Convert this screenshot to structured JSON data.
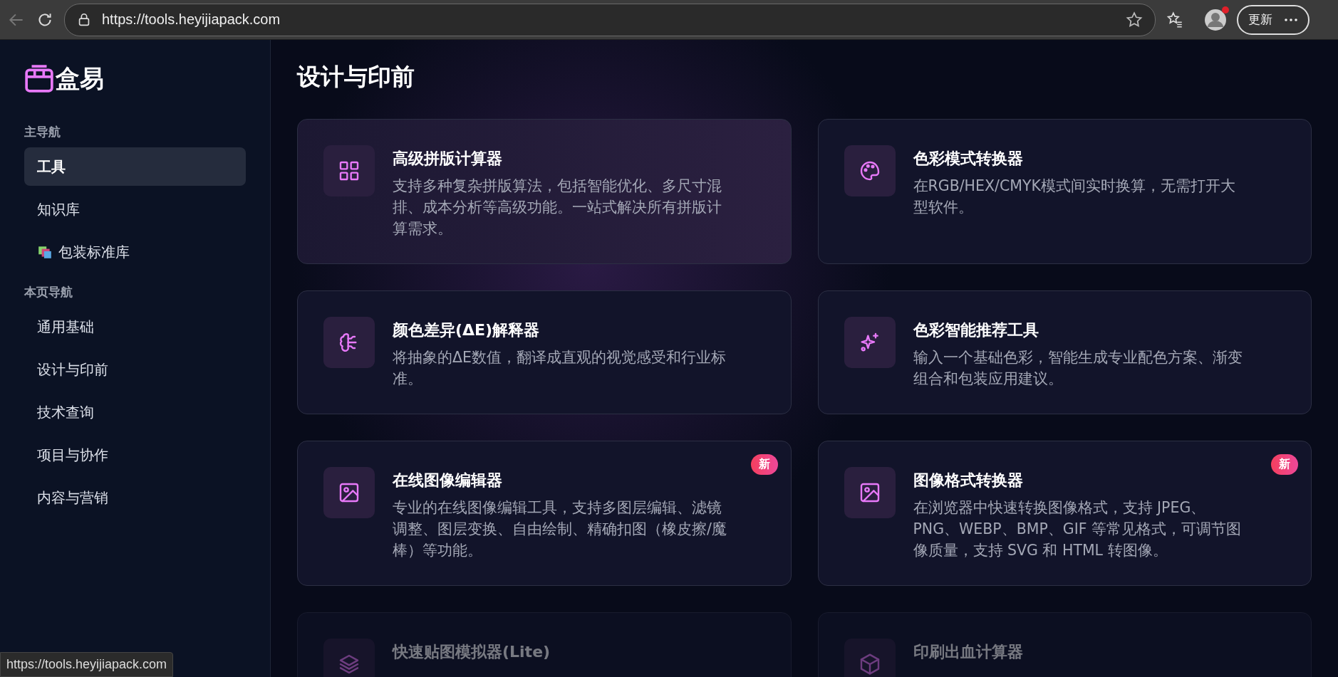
{
  "browser": {
    "url": "https://tools.heyijiapack.com",
    "update_button": "更新",
    "profile_notification": true
  },
  "sidebar": {
    "logo": "盒易",
    "sections": [
      {
        "title": "主导航",
        "items": [
          {
            "label": "工具",
            "selected": true,
            "icon": false
          },
          {
            "label": "知识库",
            "selected": false,
            "icon": false
          },
          {
            "label": "包装标准库",
            "selected": false,
            "icon": true
          }
        ]
      },
      {
        "title": "本页导航",
        "items": [
          {
            "label": "通用基础",
            "selected": false,
            "icon": false
          },
          {
            "label": "设计与印前",
            "selected": false,
            "icon": false
          },
          {
            "label": "技术查询",
            "selected": false,
            "icon": false
          },
          {
            "label": "项目与协作",
            "selected": false,
            "icon": false
          },
          {
            "label": "内容与营销",
            "selected": false,
            "icon": false
          }
        ]
      }
    ]
  },
  "page_title": "设计与印前",
  "cards": [
    {
      "kind": "grid",
      "title": "高级拼版计算器",
      "description": "支持多种复杂拼版算法，包括智能优化、多尺寸混排、成本分析等高级功能。一站式解决所有拼版计算需求。",
      "highlighted": true,
      "dimmed": false
    },
    {
      "kind": "palette",
      "title": "色彩模式转换器",
      "description": "在RGB/HEX/CMYK模式间实时换算，无需打开大型软件。",
      "highlighted": false,
      "dimmed": false
    },
    {
      "kind": "brain",
      "title": "颜色差异(ΔE)解释器",
      "description": "将抽象的ΔE数值，翻译成直观的视觉感受和行业标准。",
      "highlighted": false,
      "dimmed": false
    },
    {
      "kind": "sparkles",
      "title": "色彩智能推荐工具",
      "description": "输入一个基础色彩，智能生成专业配色方案、渐变组合和包装应用建议。",
      "highlighted": false,
      "dimmed": false
    },
    {
      "kind": "image",
      "title": "在线图像编辑器",
      "description": "专业的在线图像编辑工具，支持多图层编辑、滤镜调整、图层变换、自由绘制、精确扣图（橡皮擦/魔棒）等功能。",
      "badge": "新",
      "highlighted": false,
      "dimmed": false
    },
    {
      "kind": "image",
      "title": "图像格式转换器",
      "description": "在浏览器中快速转换图像格式，支持 JPEG、PNG、WEBP、BMP、GIF 等常见格式，可调节图像质量，支持 SVG 和 HTML 转图像。",
      "badge": "新",
      "highlighted": false,
      "dimmed": false
    },
    {
      "kind": "layers",
      "title": "快速贴图模拟器(Lite)",
      "highlighted": false,
      "dimmed": true
    },
    {
      "kind": "box",
      "title": "印刷出血计算器",
      "highlighted": false,
      "dimmed": true
    }
  ],
  "status_url": "https://tools.heyijiapack.com"
}
